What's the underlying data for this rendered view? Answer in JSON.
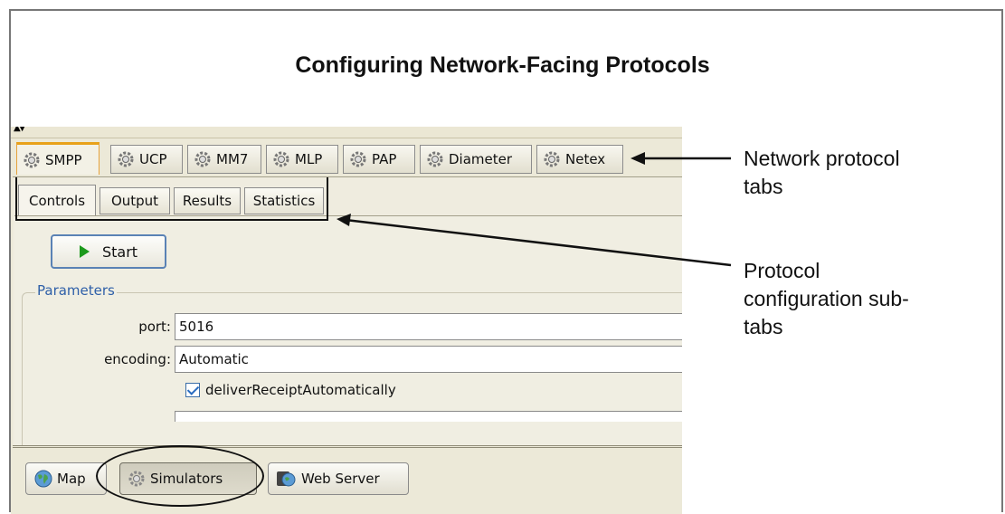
{
  "title": "Configuring Network-Facing Protocols",
  "protocol_tabs": [
    "SMPP",
    "UCP",
    "MM7",
    "MLP",
    "PAP",
    "Diameter",
    "Netex"
  ],
  "active_protocol": "SMPP",
  "sub_tabs": [
    "Controls",
    "Output",
    "Results",
    "Statistics"
  ],
  "active_sub_tab": "Controls",
  "start_button": "Start",
  "parameters": {
    "legend": "Parameters",
    "port_label": "port:",
    "port_value": "5016",
    "encoding_label": "encoding:",
    "encoding_value": "Automatic",
    "checkbox_label": "deliverReceiptAutomatically",
    "checkbox_checked": true
  },
  "bottom_buttons": [
    "Map",
    "Simulators",
    "Web Server"
  ],
  "pressed_bottom_button": "Simulators",
  "callouts": {
    "network_line1": "Network protocol",
    "network_line2": "tabs",
    "config_line1": "Protocol",
    "config_line2": "configuration sub-",
    "config_line3": "tabs"
  },
  "icons": {
    "tab_icon": "gear-icon",
    "start_icon": "play-icon",
    "map_icon": "globe-icon",
    "simulators_icon": "gear-icon",
    "web_server_icon": "globe-server-icon"
  }
}
